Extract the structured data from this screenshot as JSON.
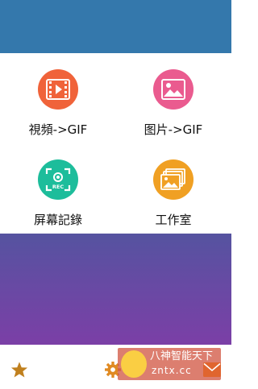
{
  "colors": {
    "header": "#3478ac",
    "video": "#f0633a",
    "image": "#ea5b8f",
    "screen_record": "#1dbd9b",
    "studio": "#f0a023",
    "gradient_top": "#5553a0",
    "gradient_bottom": "#7b3fa6",
    "star": "#c0801e",
    "gear": "#e08a22",
    "mail": "#e0652f"
  },
  "features": [
    {
      "label": "視頻->GIF",
      "icon": "film-play-icon"
    },
    {
      "label": "图片->GIF",
      "icon": "image-icon"
    },
    {
      "label": "屏幕記錄",
      "icon": "screen-record-icon",
      "badge": "REC"
    },
    {
      "label": "工作室",
      "icon": "photo-stack-icon"
    }
  ],
  "bottom_bar": {
    "buttons": [
      {
        "icon": "star-icon"
      },
      {
        "icon": "gear-icon"
      },
      {
        "icon": "mail-icon"
      }
    ]
  },
  "watermark": {
    "line1": "八神智能天下",
    "line2": "zntx.cc"
  }
}
